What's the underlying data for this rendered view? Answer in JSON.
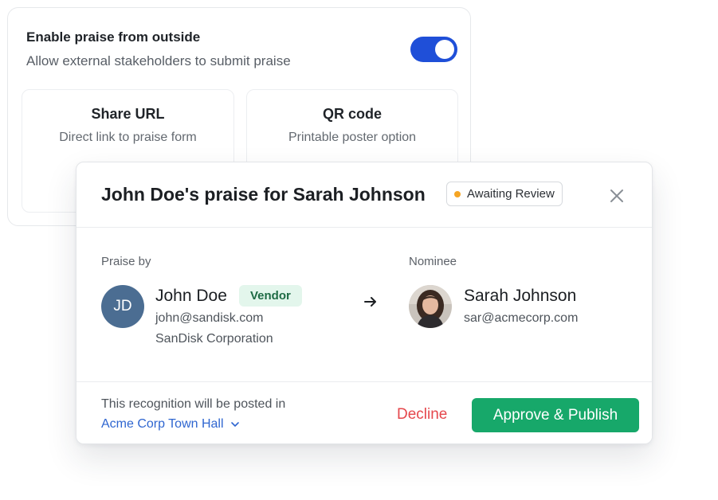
{
  "settings": {
    "title": "Enable praise from outside",
    "subtitle": "Allow external stakeholders to submit praise",
    "toggle_on": true,
    "options": [
      {
        "title": "Share URL",
        "subtitle": "Direct link to praise form"
      },
      {
        "title": "QR code",
        "subtitle": "Printable poster option"
      }
    ]
  },
  "modal": {
    "title": "John Doe's praise for Sarah Johnson",
    "status": "Awaiting Review",
    "praise_by": {
      "label": "Praise by",
      "initials": "JD",
      "name": "John Doe",
      "badge": "Vendor",
      "email": "john@sandisk.com",
      "company": "SanDisk Corporation"
    },
    "nominee": {
      "label": "Nominee",
      "name": "Sarah Johnson",
      "email": "sar@acmecorp.com"
    },
    "footer": {
      "note": "This recognition will be posted in",
      "channel": "Acme Corp Town Hall",
      "decline_label": "Decline",
      "approve_label": "Approve & Publish"
    }
  },
  "colors": {
    "toggle": "#1f4fd8",
    "status_dot": "#f5a524",
    "vendor_badge_bg": "#e3f6ec",
    "vendor_badge_text": "#1e6b45",
    "link": "#2f66d0",
    "decline": "#e5484d",
    "approve": "#17a86a",
    "avatar_jd": "#4b6d92"
  }
}
